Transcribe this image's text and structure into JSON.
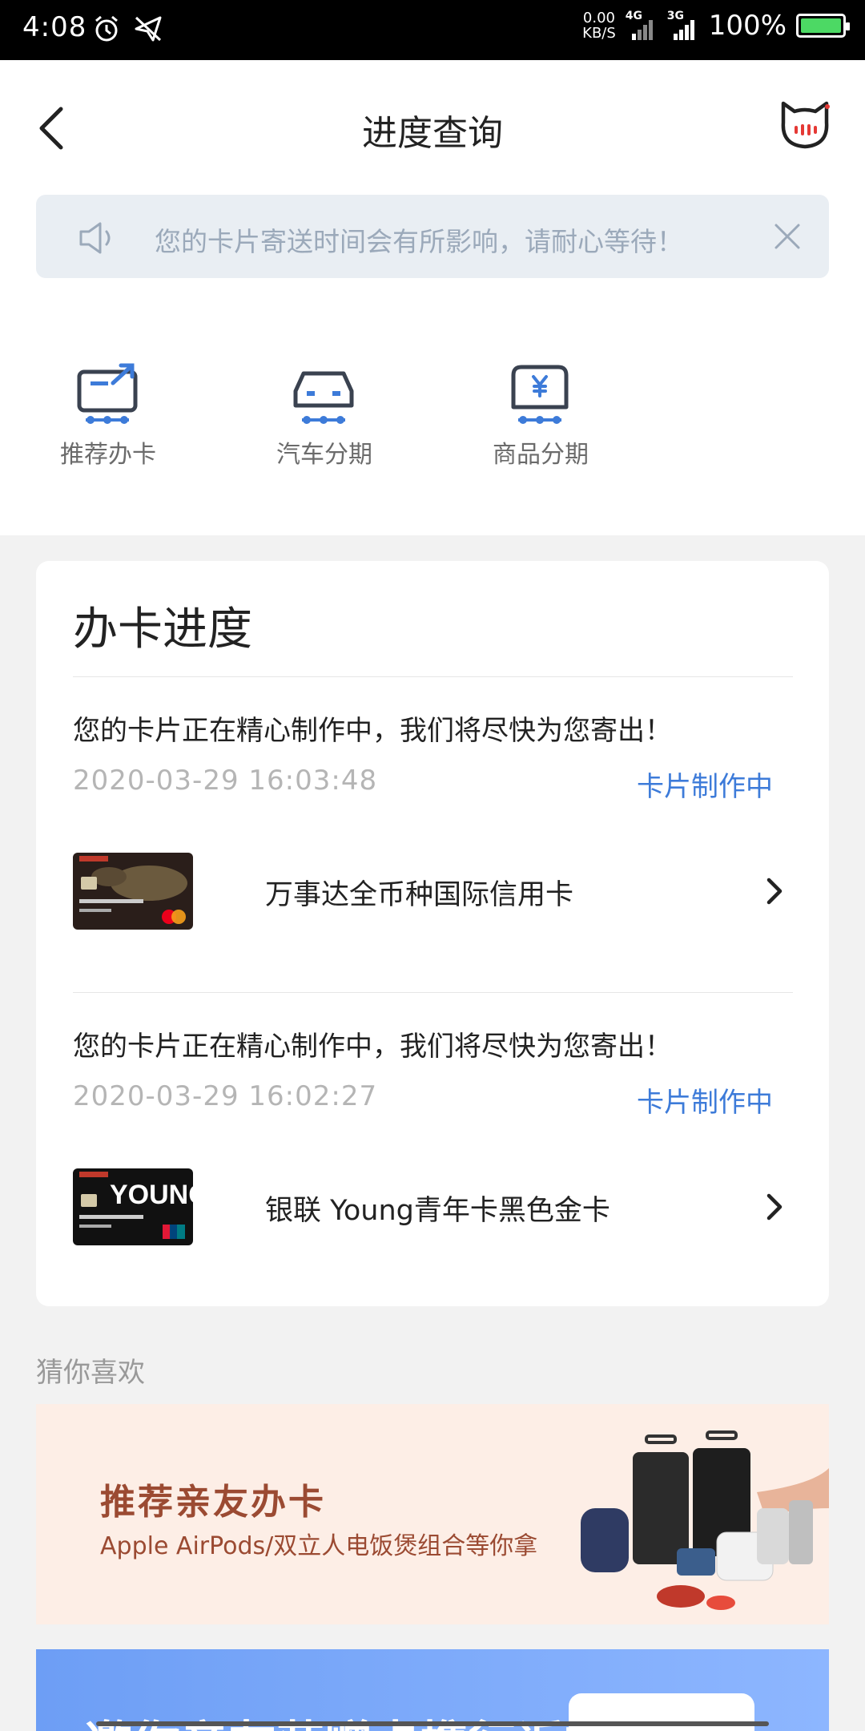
{
  "status_bar": {
    "time": "4:08",
    "net_speed_value": "0.00",
    "net_speed_unit": "KB/S",
    "signal1_label": "4G",
    "signal2_label": "3G",
    "battery_percent": "100%",
    "icons": [
      "alarm-icon",
      "send-icon",
      "signal-icon",
      "battery-icon"
    ]
  },
  "header": {
    "title": "进度查询",
    "back_icon": "chevron-left-icon",
    "assistant_icon": "mascot-icon"
  },
  "notice": {
    "text": "您的卡片寄送时间会有所影响，请耐心等待！",
    "icon": "speaker-icon",
    "close_icon": "close-icon"
  },
  "shortcuts": [
    {
      "label": "推荐办卡",
      "icon": "share-card-icon"
    },
    {
      "label": "汽车分期",
      "icon": "car-icon"
    },
    {
      "label": "商品分期",
      "icon": "yen-bag-icon"
    }
  ],
  "progress": {
    "title": "办卡进度",
    "entries": [
      {
        "message": "您的卡片正在精心制作中，我们将尽快为您寄出！",
        "time": "2020-03-29  16:03:48",
        "status": "卡片制作中",
        "card_name": "万事达全币种国际信用卡"
      },
      {
        "message": "您的卡片正在精心制作中，我们将尽快为您寄出！",
        "time": "2020-03-29  16:02:27",
        "status": "卡片制作中",
        "card_name": "银联 Young青年卡黑色金卡"
      }
    ]
  },
  "recommend": {
    "label": "猜你喜欢",
    "banner1_title": "推荐亲友办卡",
    "banner1_subtitle": "Apple AirPods/双立人电饭煲组合等你拿",
    "banner2_text": "邀你亲友获赠卡携行返旅中"
  },
  "colors": {
    "accent": "#3d7bd9",
    "notice_bg": "#e9eef3",
    "banner1_text": "#9b4a32",
    "banner2_bg": "#6d9ef5"
  }
}
